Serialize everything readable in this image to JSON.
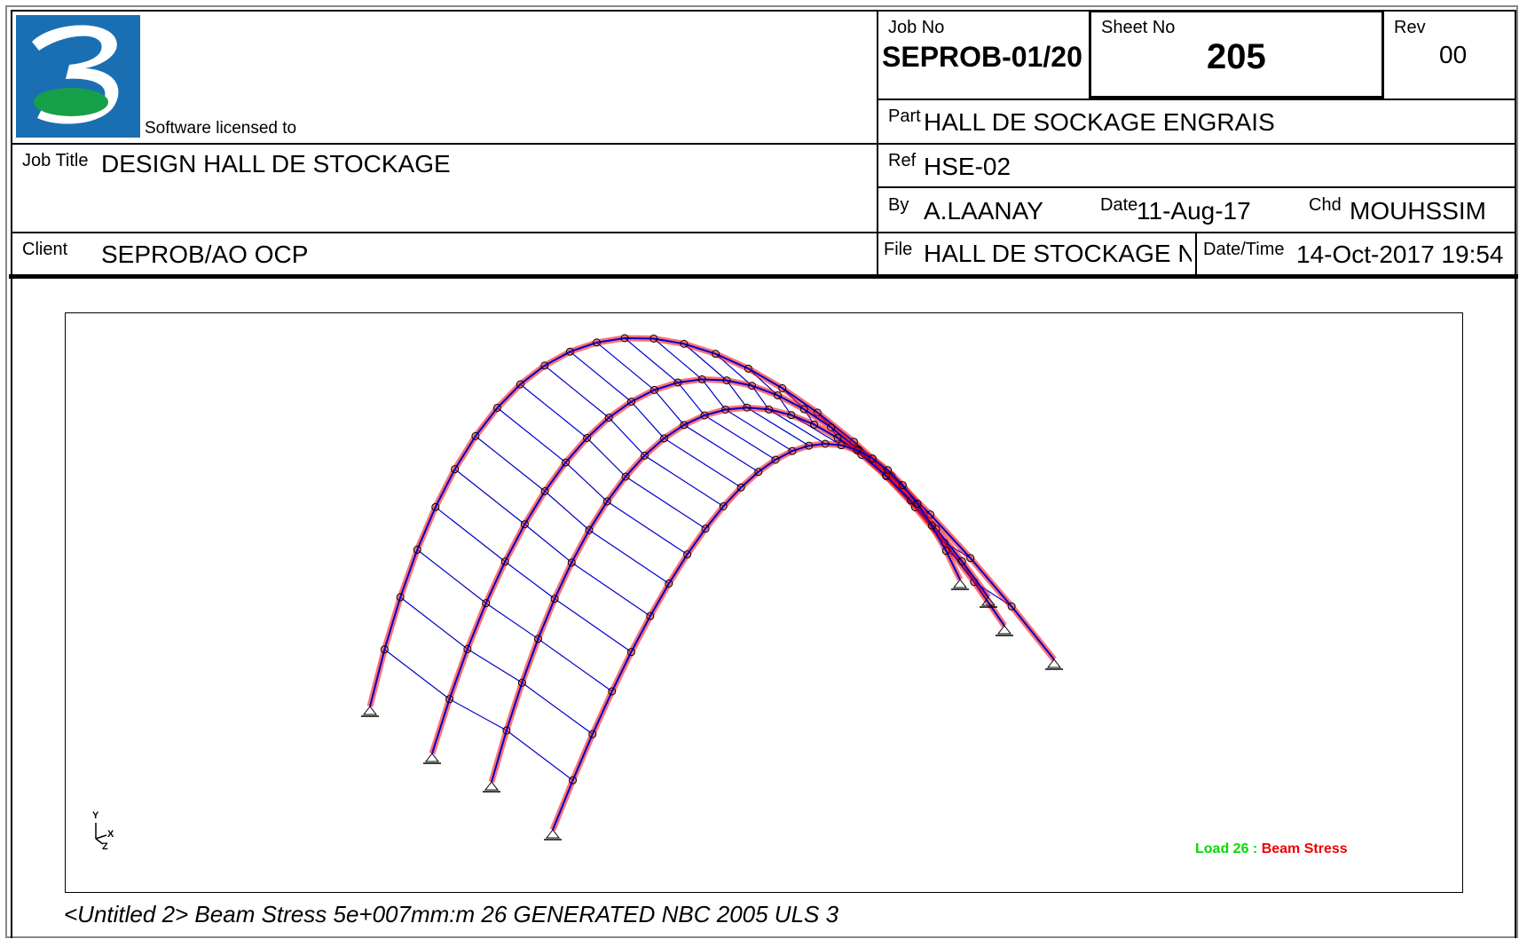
{
  "header": {
    "licensed_label": "Software licensed to",
    "job_no_label": "Job No",
    "job_no_value": "SEPROB-01/20",
    "sheet_no_label": "Sheet No",
    "sheet_no_value": "205",
    "rev_label": "Rev",
    "rev_value": "00",
    "part_label": "Part",
    "part_value": "HALL DE SOCKAGE ENGRAIS",
    "job_title_label": "Job Title",
    "job_title_value": "DESIGN HALL DE STOCKAGE",
    "ref_label": "Ref",
    "ref_value": "HSE-02",
    "by_label": "By",
    "by_value": "A.LAANAY",
    "date_label": "Date",
    "date_value": "11-Aug-17",
    "chd_label": "Chd",
    "chd_value": "MOUHSSIM",
    "client_label": "Client",
    "client_value": "SEPROB/AO OCP",
    "file_label": "File",
    "file_value": "HALL DE STOCKAGE N´",
    "datetime_label": "Date/Time",
    "datetime_value": "14-Oct-2017 19:54"
  },
  "drawing": {
    "axis_y": "Y",
    "axis_x": "X",
    "axis_z": "Z",
    "legend_load": "Load 26 :",
    "legend_type": "Beam Stress",
    "legend_load_color": "#00dd00",
    "legend_type_color": "#ee0000",
    "member_color": "#0000cc",
    "stress_color": "#ff0000",
    "caption": "<Untitled 2> Beam Stress 5e+007mm:m 26 GENERATED NBC 2005 ULS 3"
  },
  "logo": {
    "icon": "staad-logo",
    "bg_color": "#1a6fb3",
    "accent_color": "#16a04a"
  }
}
